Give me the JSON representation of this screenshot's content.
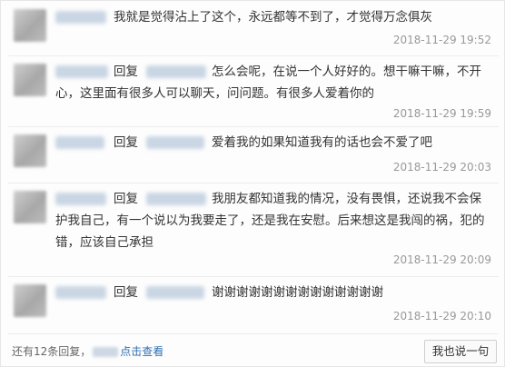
{
  "comments": [
    {
      "text": "我就是觉得沾上了这个，永远都等不到了，才觉得万念俱灰",
      "time": "2018-11-29 19:52",
      "action": "回复",
      "is_reply": false
    },
    {
      "action": "回复",
      "text": "怎么会呢，在说一个人好好的。想干嘛干嘛，不开心，这里面有很多人可以聊天，问问题。有很多人爱着你的",
      "time": "2018-11-29 19:59",
      "is_reply": true
    },
    {
      "action": "回复",
      "text": "爱着我的如果知道我有的话也会不爱了吧",
      "time": "2018-11-29 20:03",
      "is_reply": true
    },
    {
      "action": "回复",
      "text": "我朋友都知道我的情况，没有畏惧，还说我不会保护我自己，有一个说以为我要走了，还是我在安慰。后来想这是我闯的祸，犯的错，应该自己承担",
      "time": "2018-11-29 20:09",
      "is_reply": true
    },
    {
      "action": "回复",
      "text": "谢谢谢谢谢谢谢谢谢谢谢谢谢谢",
      "time": "2018-11-29 20:10",
      "is_reply": true
    }
  ],
  "footer": {
    "prefix": "还有12条回复，",
    "link": "点击查看",
    "button": "我也说一句"
  }
}
